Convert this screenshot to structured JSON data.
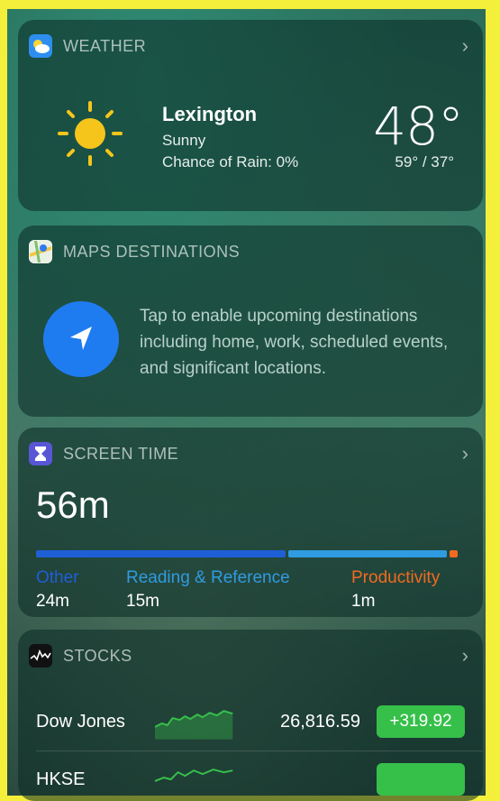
{
  "weather": {
    "title": "WEATHER",
    "city": "Lexington",
    "condition": "Sunny",
    "rain": "Chance of Rain: 0%",
    "temperature": "48°",
    "hilo": "59° / 37°"
  },
  "maps": {
    "title": "MAPS DESTINATIONS",
    "message": "Tap to enable upcoming destinations including home, work, scheduled events, and significant locations."
  },
  "screen_time": {
    "title": "SCREEN TIME",
    "total": "56m",
    "categories": [
      {
        "label": "Other",
        "value": "24m",
        "color": "#1e5fd6",
        "fraction": 0.6
      },
      {
        "label": "Reading & Reference",
        "value": "15m",
        "color": "#2f9be0",
        "fraction": 0.38
      },
      {
        "label": "Productivity",
        "value": "1m",
        "color": "#f26a21",
        "fraction": 0.02
      }
    ]
  },
  "stocks": {
    "title": "STOCKS",
    "rows": [
      {
        "name": "Dow Jones",
        "price": "26,816.59",
        "change": "+319.92"
      },
      {
        "name": "HKSE",
        "price": "",
        "change": ""
      }
    ]
  }
}
